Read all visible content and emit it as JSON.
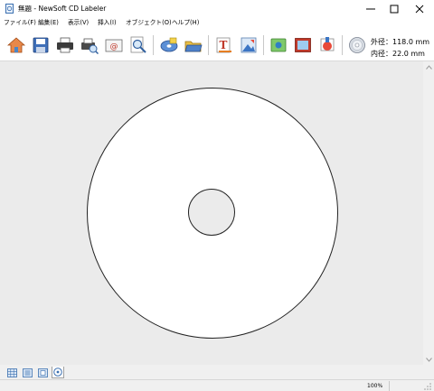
{
  "window": {
    "title": "無題 - NewSoft CD Labeler"
  },
  "menu": [
    "ファイル(F)",
    "編集(E)",
    "表示(V)",
    "挿入(I)",
    "オブジェクト(O)",
    "ヘルプ(H)"
  ],
  "toolbar": {
    "icons": [
      "home-icon",
      "save-icon",
      "print-icon",
      "print-preview-icon",
      "email-icon",
      "zoom-icon",
      "disc-template-icon",
      "open-folder-icon",
      "insert-text-icon",
      "insert-image-icon",
      "background-icon",
      "frame-icon",
      "clipart-icon",
      "disc-size-icon"
    ]
  },
  "disc_info": {
    "outer_label": "外径：",
    "outer_value": "118.0 mm",
    "inner_label": "内径：",
    "inner_value": "22.0 mm"
  },
  "view_tabs": [
    "grid-view-icon",
    "list-view-icon",
    "booklet-view-icon",
    "disc-view-icon"
  ],
  "status": {
    "zoom": "100%"
  },
  "colors": {
    "workspace_bg": "#ebebeb",
    "disc_fill": "#ffffff",
    "outline": "#222222"
  }
}
